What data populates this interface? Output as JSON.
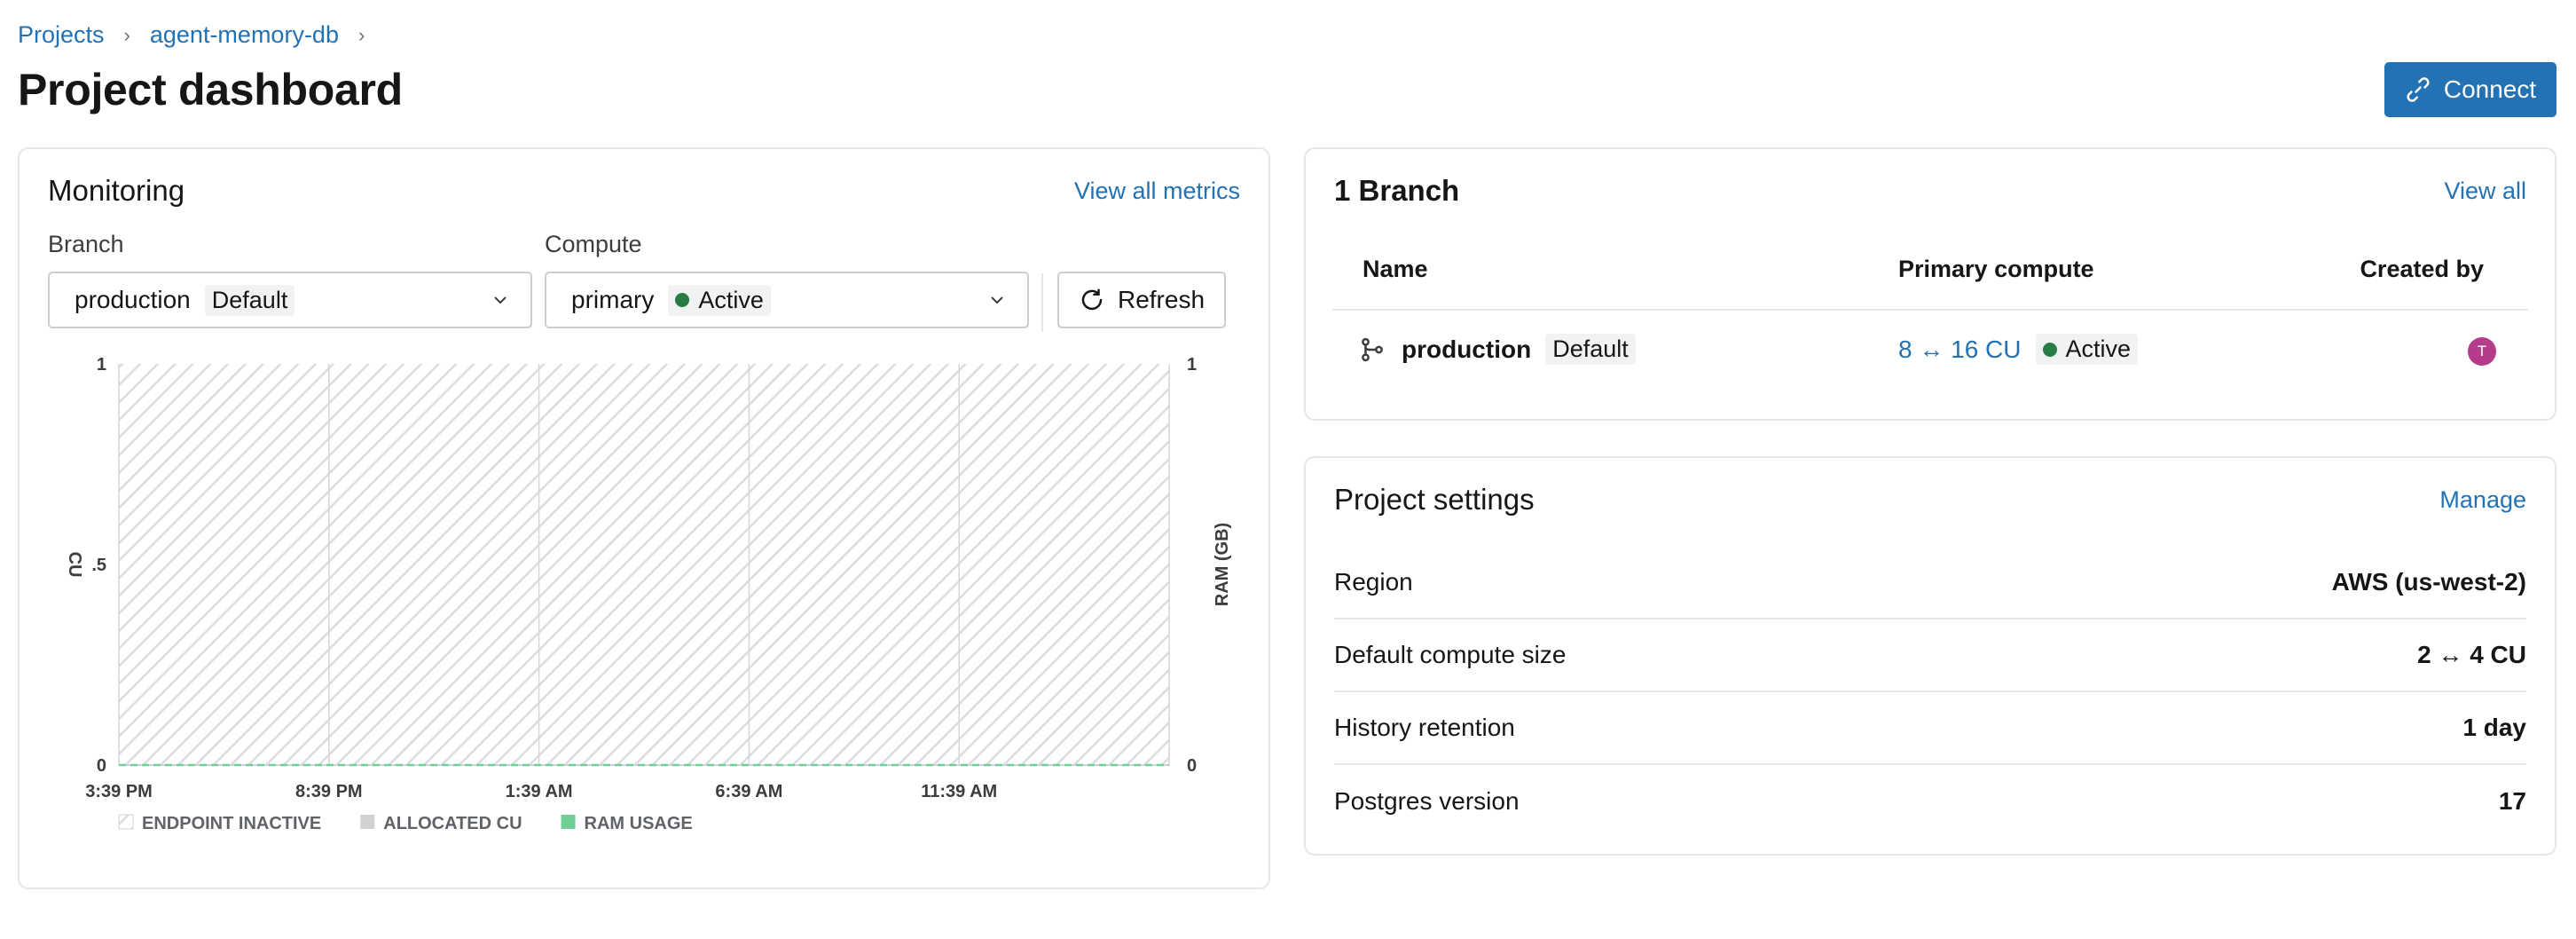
{
  "breadcrumb": {
    "items": [
      "Projects",
      "agent-memory-db"
    ],
    "separator": "›"
  },
  "page": {
    "title": "Project dashboard"
  },
  "header": {
    "connect_label": "Connect"
  },
  "monitoring": {
    "title": "Monitoring",
    "view_all_label": "View all metrics",
    "branch_label": "Branch",
    "branch_value": "production",
    "branch_tag": "Default",
    "compute_label": "Compute",
    "compute_value": "primary",
    "compute_status": "Active",
    "refresh_label": "Refresh"
  },
  "chart_data": {
    "type": "area",
    "title": "",
    "x": [
      "3:39 PM",
      "8:39 PM",
      "1:39 AM",
      "6:39 AM",
      "11:39 AM"
    ],
    "ylabel": "CU",
    "y2label": "RAM (GB)",
    "y_ticks": [
      "0",
      ".5",
      "1"
    ],
    "y2_ticks": [
      "0",
      "1"
    ],
    "ylim": [
      0,
      1
    ],
    "y2lim": [
      0,
      1
    ],
    "grid": true,
    "legend_position": "bottom-left",
    "legend": [
      "ENDPOINT INACTIVE",
      "ALLOCATED CU",
      "RAM USAGE"
    ],
    "series": [
      {
        "name": "ENDPOINT INACTIVE",
        "values": [
          1,
          1,
          1,
          1,
          1
        ]
      },
      {
        "name": "ALLOCATED CU",
        "values": [
          0,
          0,
          0,
          0,
          0
        ]
      },
      {
        "name": "RAM USAGE",
        "values": [
          0,
          0,
          0,
          0,
          0
        ]
      }
    ],
    "colors": {
      "inactive": "#dadde0",
      "allocated": "#cfd3d7",
      "ram": "#6fcf97"
    }
  },
  "branches": {
    "title": "1 Branch",
    "view_all_label": "View all",
    "columns": [
      "Name",
      "Primary compute",
      "Created by"
    ],
    "rows": [
      {
        "name": "production",
        "tag": "Default",
        "compute": "8 ↔ 16 CU",
        "status": "Active",
        "avatar": "T"
      }
    ]
  },
  "settings": {
    "title": "Project settings",
    "manage_label": "Manage",
    "rows": [
      {
        "label": "Region",
        "value": "AWS (us-west-2)"
      },
      {
        "label": "Default compute size",
        "value": "2 ↔ 4 CU"
      },
      {
        "label": "History retention",
        "value": "1 day"
      },
      {
        "label": "Postgres version",
        "value": "17"
      }
    ]
  },
  "colors": {
    "accent": "#2272b4",
    "active": "#277c43",
    "avatar": "#b43c8a"
  }
}
